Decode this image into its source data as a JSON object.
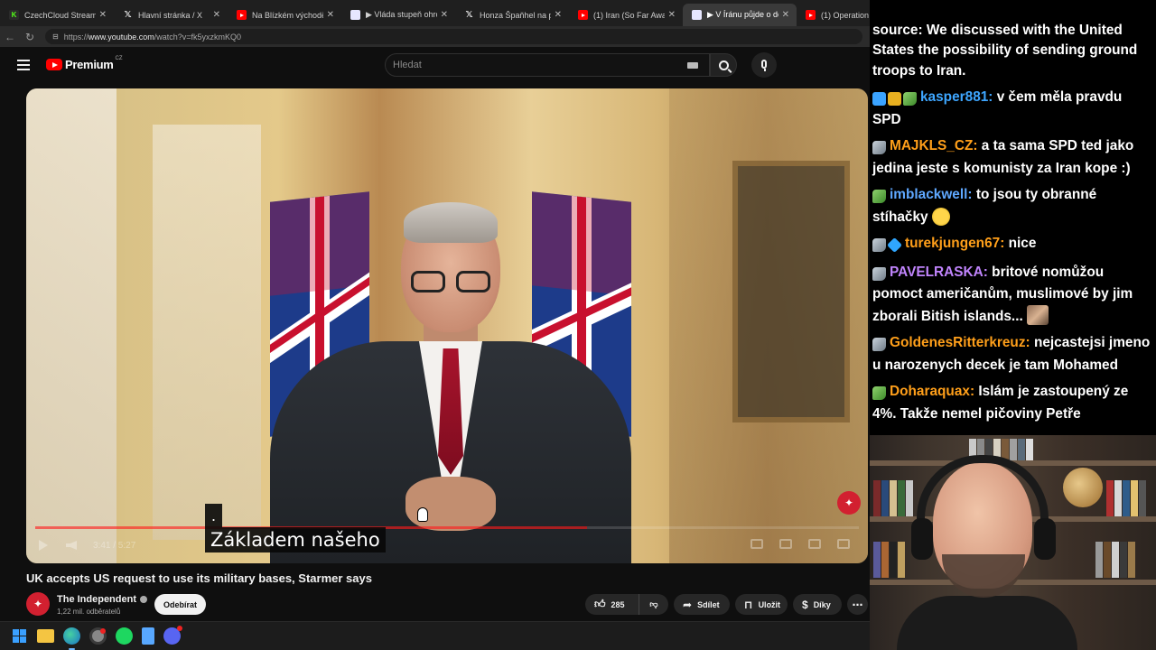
{
  "browser": {
    "tabs": [
      {
        "title": "CzechCloud Stream - W",
        "icon": "kick"
      },
      {
        "title": "Hlavní stránka / X",
        "icon": "x"
      },
      {
        "title": "Na Blízkém východě jso",
        "icon": "youtube"
      },
      {
        "title": "▶ Vláda stupeň ohrožen",
        "icon": "copilot"
      },
      {
        "title": "Honza Špaňhel na platfo",
        "icon": "x"
      },
      {
        "title": "(1) Iran (So Far Away) - C",
        "icon": "youtube"
      },
      {
        "title": "▶ V Íránu půjde o delší",
        "icon": "copilot"
      },
      {
        "title": "(1) Operation Ep",
        "icon": "youtube"
      }
    ],
    "url_prefix": "https://",
    "url_domain": "www.youtube.com",
    "url_path": "/watch?v=fk5yxzkmKQ0"
  },
  "youtube": {
    "logo_text": "Premium",
    "country": "CZ",
    "search_placeholder": "Hledat",
    "video": {
      "caption_top": ".",
      "caption_main": "Základem našeho",
      "time": "3:41 / 5:27",
      "progress": 0.67
    },
    "title": "UK accepts US request to use its military bases, Starmer says",
    "channel": {
      "name": "The Independent",
      "subscribers": "1,22 mil. odběratelů",
      "subscribe_label": "Odebírat"
    },
    "actions": {
      "likes": "285",
      "share": "Sdílet",
      "save": "Uložit",
      "thanks": "Díky",
      "more": "⋯"
    }
  },
  "chat": {
    "messages": [
      {
        "user": "",
        "user_color": "#ffffff",
        "text": "source: We discussed with the United States the possibility of sending ground troops to Iran."
      },
      {
        "user": "kasper881:",
        "user_color": "#3ea6ff",
        "text": "v čem měla pravdu SPD"
      },
      {
        "user": "MAJKLS_CZ:",
        "user_color": "#ff9f1a",
        "text": "a ta sama SPD ted jako jedina jeste s komunisty za Iran kope :)"
      },
      {
        "user": "imblackwell:",
        "user_color": "#5fa8ff",
        "text": "to jsou ty obranné stíhačky"
      },
      {
        "user": "turekjungen67:",
        "user_color": "#ff9f1a",
        "text": "nice"
      },
      {
        "user": "PAVELRASKA:",
        "user_color": "#c084fc",
        "text": "britové nomůžou pomoct američanům, muslimové by jim zborali Bitish islands..."
      },
      {
        "user": "GoldenesRitterkreuz:",
        "user_color": "#ff9f1a",
        "text": "nejcastejsi jmeno u narozenych decek je tam Mohamed"
      },
      {
        "user": "Doharaquax:",
        "user_color": "#ff9f1a",
        "text": "Islám je zastoupený ze 4%. Takže nemel pičoviny Petře"
      }
    ]
  },
  "colors": {
    "accent_red": "#ff0000",
    "bg": "#0f0f0f"
  }
}
